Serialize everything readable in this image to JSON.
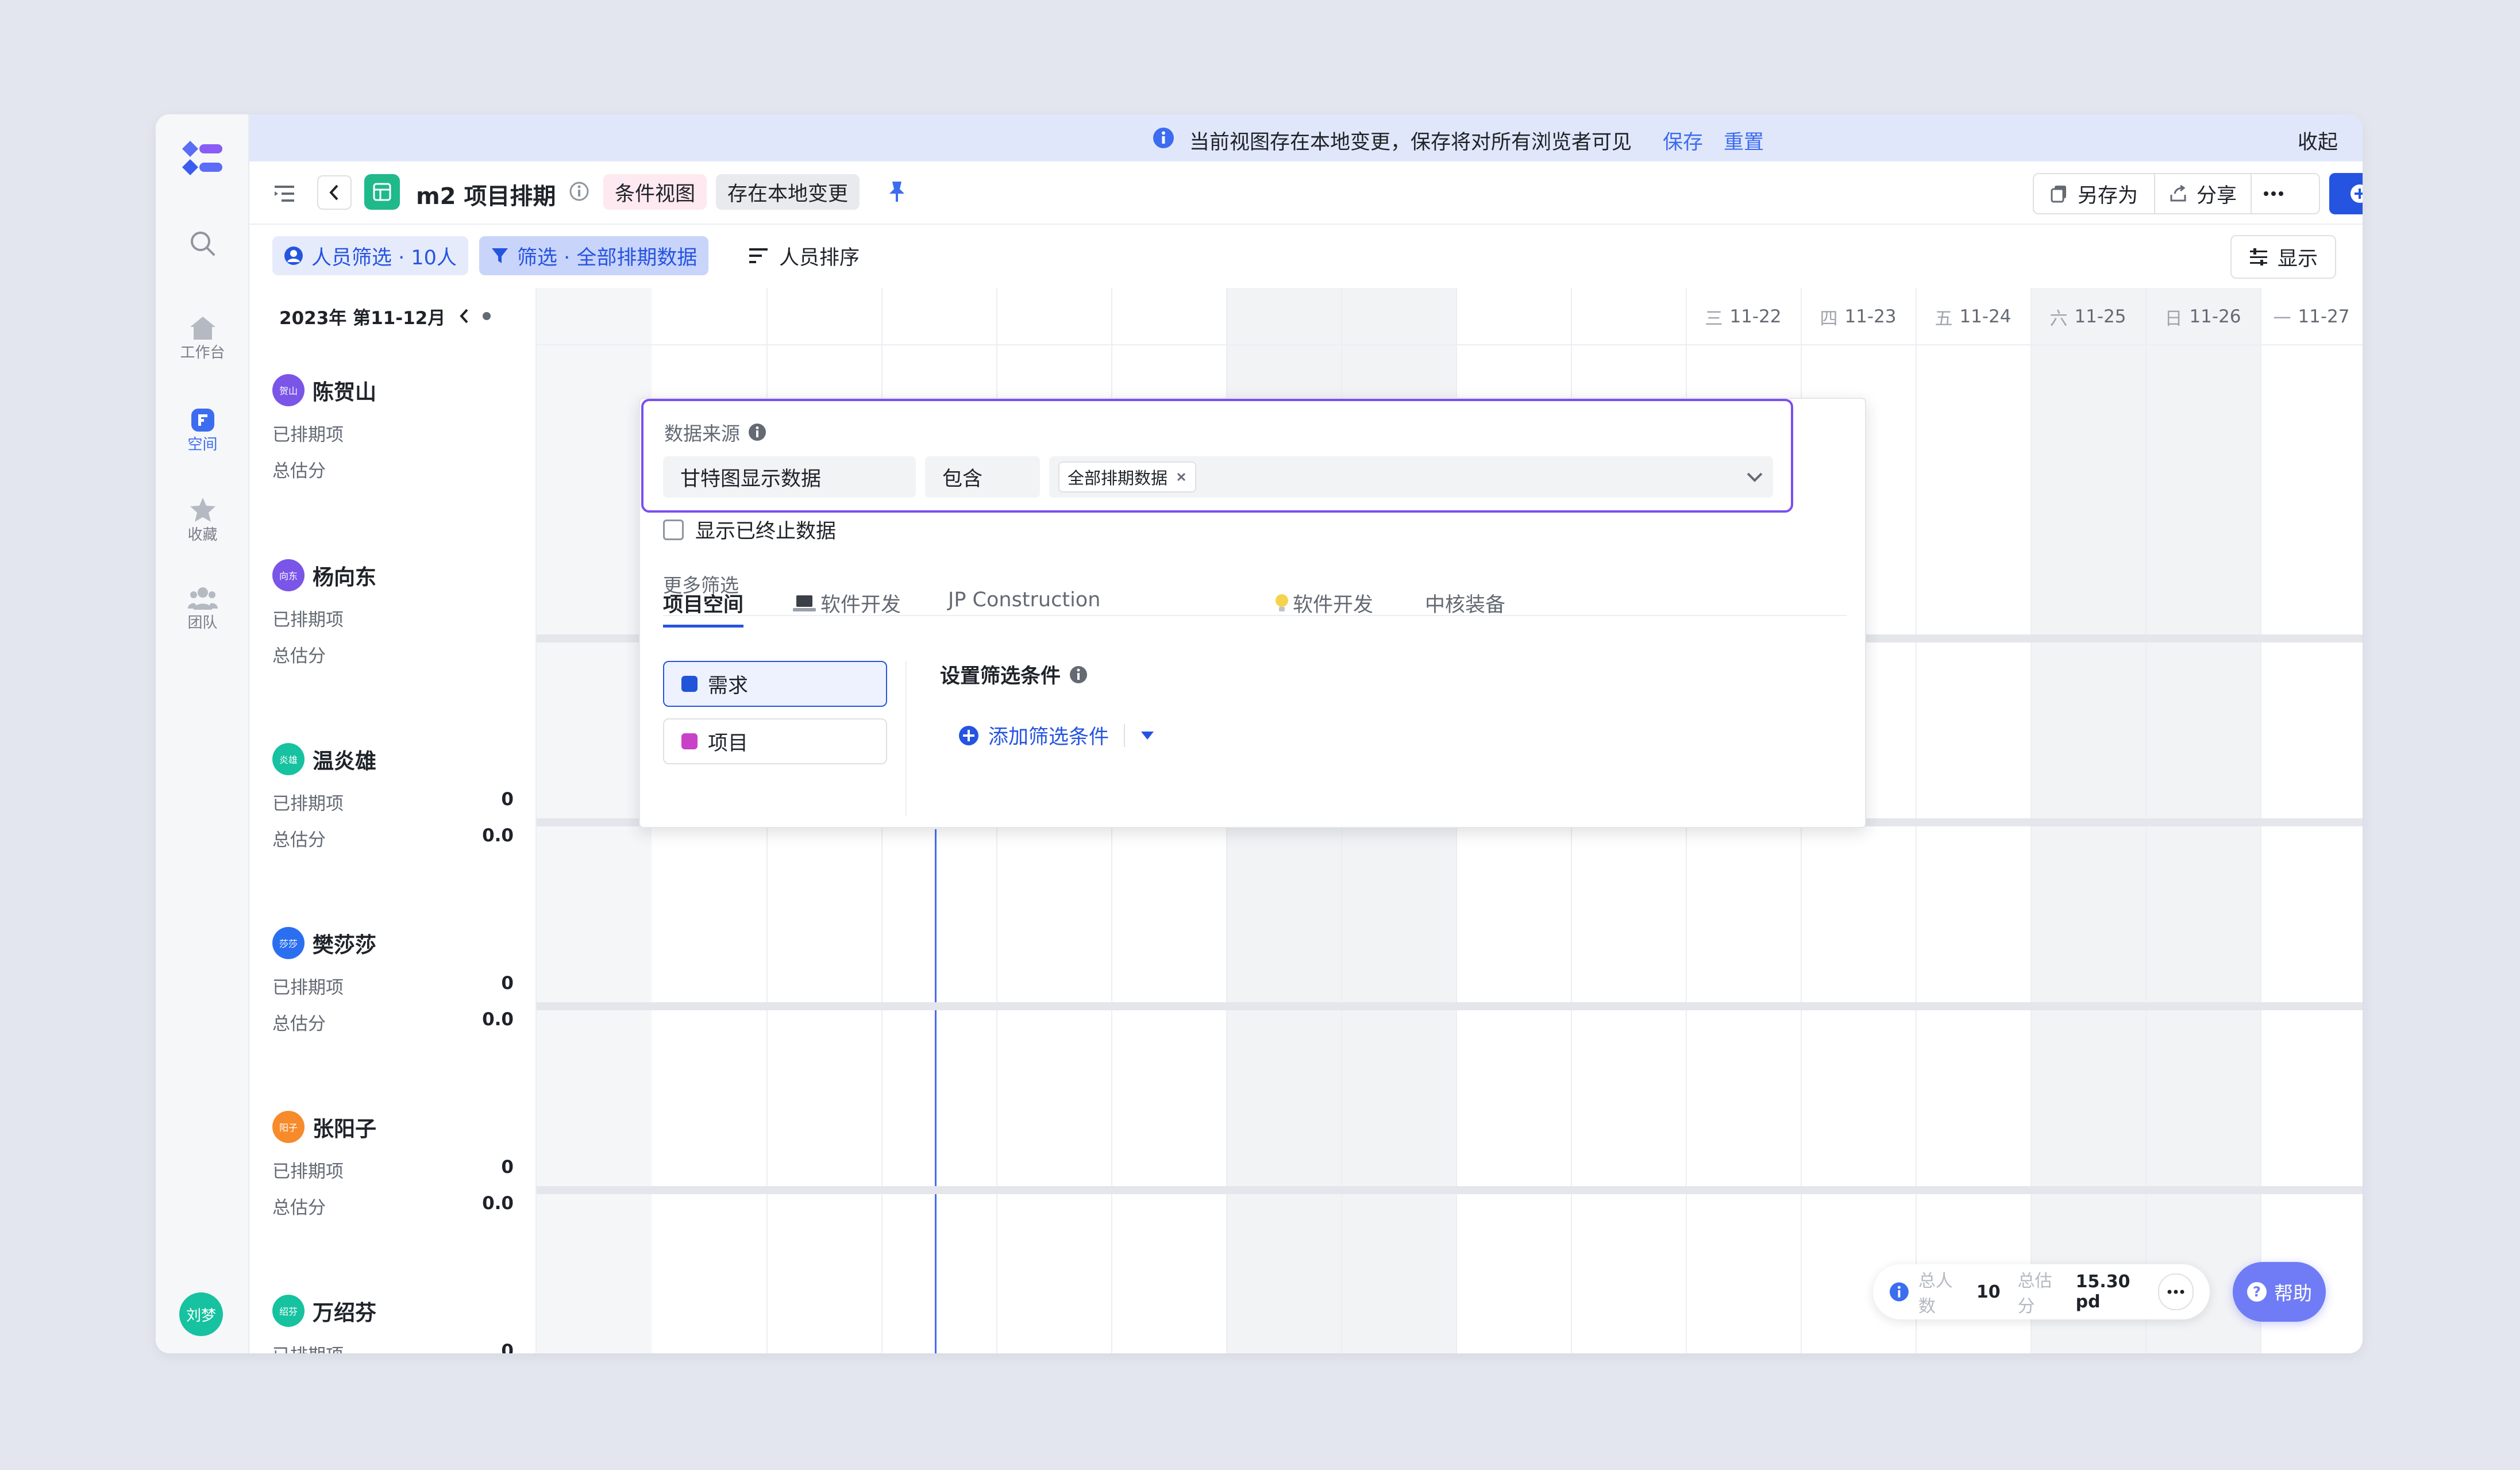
{
  "banner": {
    "message": "当前视图存在本地变更，保存将对所有浏览者可见",
    "save": "保存",
    "reset": "重置",
    "collapse": "收起"
  },
  "sidebar": {
    "items": [
      {
        "label": "工作台"
      },
      {
        "label": "空间"
      },
      {
        "label": "收藏"
      },
      {
        "label": "团队"
      }
    ],
    "user_avatar": "刘梦"
  },
  "toolbar": {
    "title": "m2 项目排期",
    "view_tag": "条件视图",
    "local_change_tag": "存在本地变更",
    "save_as": "另存为",
    "share": "分享",
    "new": "新建"
  },
  "filterbar": {
    "people_filter": "人员筛选 · 10人",
    "data_filter": "筛选 · 全部排期数据",
    "people_sort": "人员排序",
    "display": "显示"
  },
  "calendar": {
    "period": "2023年 第11-12月",
    "days": [
      {
        "weekday": "三",
        "date": "11-22"
      },
      {
        "weekday": "四",
        "date": "11-23"
      },
      {
        "weekday": "五",
        "date": "11-24"
      },
      {
        "weekday": "六",
        "date": "11-25"
      },
      {
        "weekday": "日",
        "date": "11-26"
      },
      {
        "weekday": "一",
        "date": "11-27"
      }
    ]
  },
  "people": [
    {
      "avatar": "贺山",
      "name": "陈贺山",
      "scheduled_label": "已排期项",
      "estimate_label": "总估分",
      "scheduled": "",
      "estimate": "",
      "color": "#7a55e8"
    },
    {
      "avatar": "向东",
      "name": "杨向东",
      "scheduled_label": "已排期项",
      "estimate_label": "总估分",
      "scheduled": "",
      "estimate": "",
      "color": "#7a55e8"
    },
    {
      "avatar": "炎雄",
      "name": "温炎雄",
      "scheduled_label": "已排期项",
      "estimate_label": "总估分",
      "scheduled": "0",
      "estimate": "0.0",
      "color": "#16c2a0"
    },
    {
      "avatar": "莎莎",
      "name": "樊莎莎",
      "scheduled_label": "已排期项",
      "estimate_label": "总估分",
      "scheduled": "0",
      "estimate": "0.0",
      "color": "#2a6ff0"
    },
    {
      "avatar": "阳子",
      "name": "张阳子",
      "scheduled_label": "已排期项",
      "estimate_label": "总估分",
      "scheduled": "0",
      "estimate": "0.0",
      "color": "#f78a2a"
    },
    {
      "avatar": "绍芬",
      "name": "万绍芬",
      "scheduled_label": "已排期项",
      "estimate_label": "总估分",
      "scheduled": "0",
      "estimate": "",
      "color": "#16c2a0"
    }
  ],
  "popup": {
    "source_label": "数据来源",
    "source_field": "甘特图显示数据",
    "operator": "包含",
    "value_tag": "全部排期数据",
    "show_terminated": "显示已终止数据",
    "more_filters": "更多筛选",
    "tabs": [
      "项目空间",
      "软件开发",
      "JP Construction",
      "软件开发",
      "中核装备"
    ],
    "types": [
      {
        "label": "需求",
        "color": "#2154d8"
      },
      {
        "label": "项目",
        "color": "#c940c9"
      }
    ],
    "condition_title": "设置筛选条件",
    "add_condition": "添加筛选条件"
  },
  "summary": {
    "people_label": "总人数",
    "people_value": "10",
    "estimate_label": "总估分",
    "estimate_value": "15.30 pd"
  },
  "help": "帮助",
  "colors": {
    "accent": "#3c6cf0",
    "purple": "#7b4ff0",
    "filter_bg": "#dde4fb"
  }
}
